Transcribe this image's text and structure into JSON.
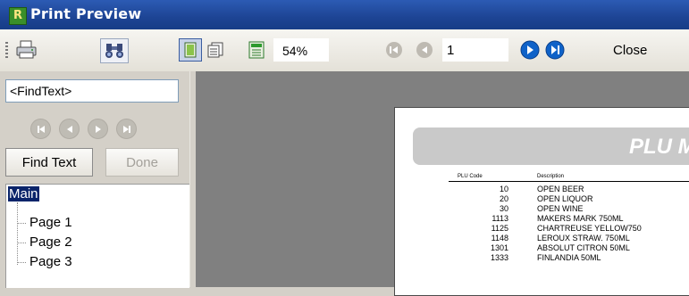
{
  "window": {
    "title": "Print Preview",
    "app_icon_letter": "R"
  },
  "toolbar": {
    "print_icon": "printer-icon",
    "find_icon": "binoculars-icon",
    "single_page_icon": "single-page-view-icon",
    "multi_page_icon": "multi-page-view-icon",
    "page_setup_icon": "page-setup-icon",
    "zoom_value": "54%",
    "first_icon": "first-page-icon",
    "prev_icon": "previous-page-icon",
    "page_number": "1",
    "next_icon": "next-page-icon",
    "last_icon": "last-page-icon",
    "close_label": "Close"
  },
  "find_panel": {
    "find_text_value": "<FindText>",
    "find_button_label": "Find Text",
    "done_button_label": "Done"
  },
  "tree": {
    "root_label": "Main",
    "pages": [
      "Page 1",
      "Page 2",
      "Page 3"
    ]
  },
  "report": {
    "title": "PLU M",
    "columns": {
      "code": "PLU Code",
      "description": "Description"
    },
    "rows": [
      {
        "code": "10",
        "description": "OPEN BEER"
      },
      {
        "code": "20",
        "description": "OPEN LIQUOR"
      },
      {
        "code": "30",
        "description": "OPEN WINE"
      },
      {
        "code": "1113",
        "description": "MAKERS MARK 750ML"
      },
      {
        "code": "1125",
        "description": "CHARTREUSE YELLOW750"
      },
      {
        "code": "1148",
        "description": "LEROUX STRAW. 750ML"
      },
      {
        "code": "1301",
        "description": "ABSOLUT CITRON 50ML"
      },
      {
        "code": "1333",
        "description": "FINLANDIA 50ML"
      }
    ]
  },
  "colors": {
    "titlebar": "#1d4494",
    "nav_blue": "#0f62c8",
    "selection": "#0a246a",
    "viewer_bg": "#808080"
  }
}
